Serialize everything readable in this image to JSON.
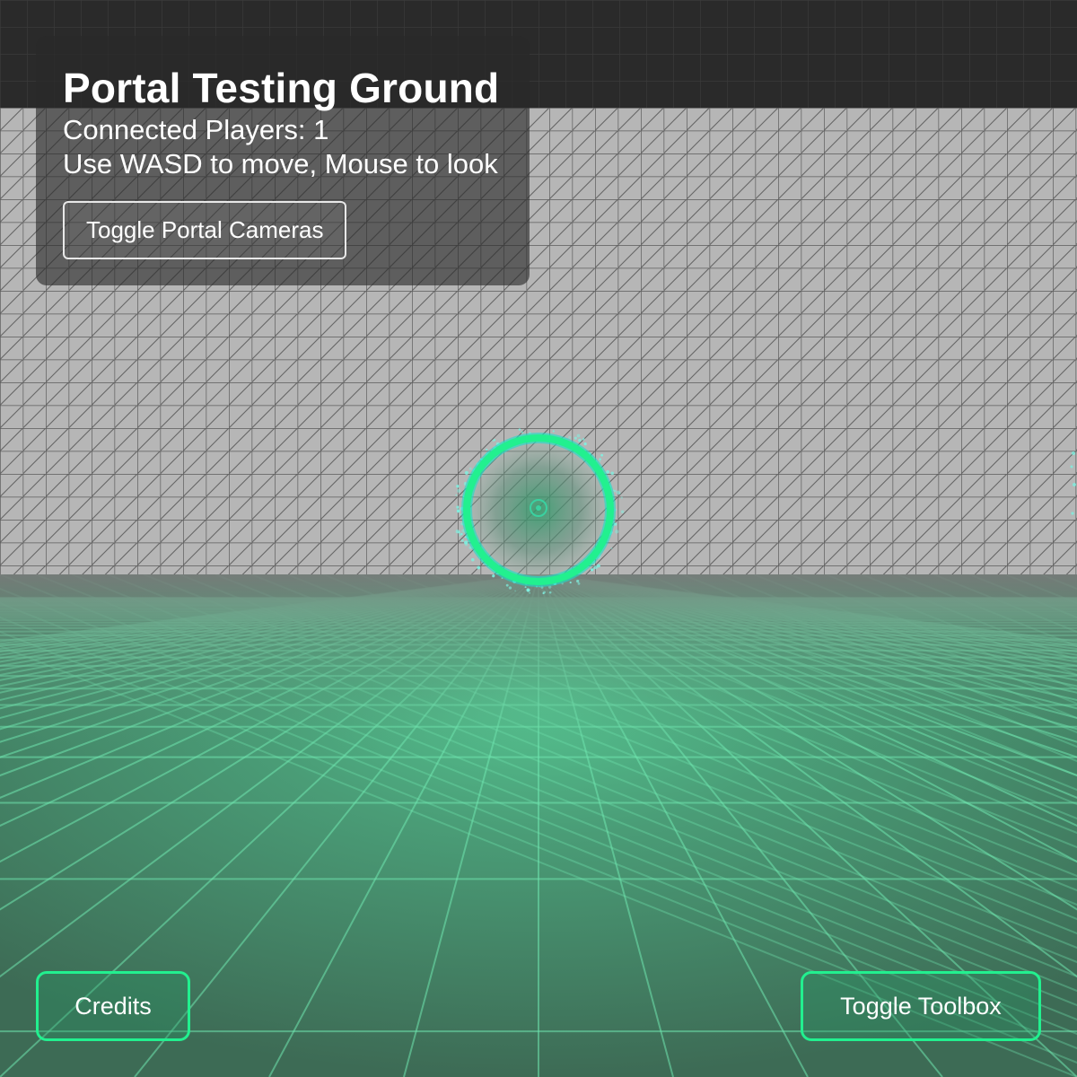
{
  "hud": {
    "title": "Portal Testing Ground",
    "connected_players": "Connected Players: 1",
    "instructions": "Use WASD to move, Mouse to look",
    "toggle_cameras_label": "Toggle Portal Cameras"
  },
  "buttons": {
    "credits_label": "Credits",
    "toolbox_label": "Toggle Toolbox"
  },
  "colors": {
    "accent_green": "#22f08f",
    "portal_cyan": "#19e0c8",
    "wall_gray": "#b4b4b4",
    "floor_green": "#3f7a5c",
    "sky_dark": "#262626"
  },
  "scene": {
    "objects": [
      "wall-grid",
      "floor-grid",
      "portal-ring"
    ]
  }
}
